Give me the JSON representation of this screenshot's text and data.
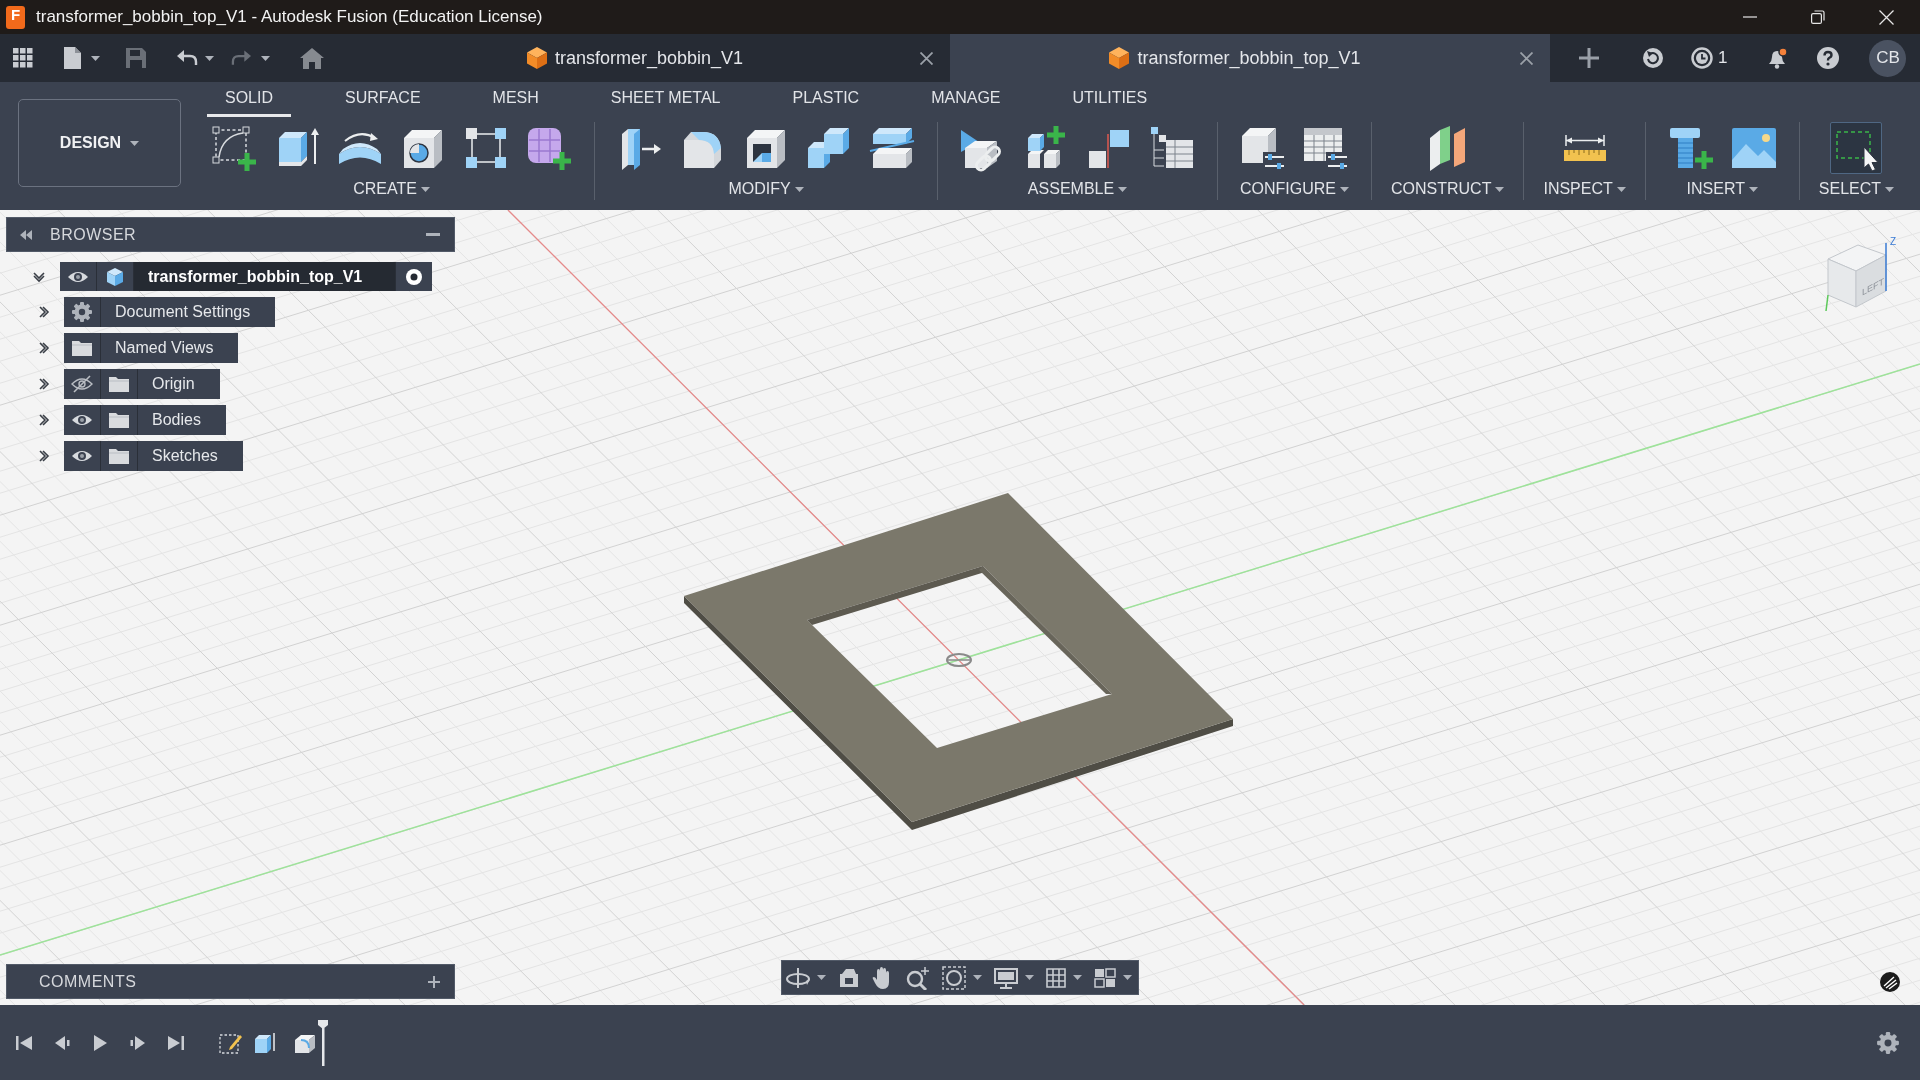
{
  "window": {
    "logo": "F",
    "title": "transformer_bobbin_top_V1 - Autodesk Fusion (Education License)"
  },
  "quick_access": {
    "save": {
      "disabled": true
    },
    "undo": {
      "disabled": false
    },
    "redo": {
      "disabled": true
    }
  },
  "document_tabs": [
    {
      "title": "transformer_bobbin_V1",
      "selected": false
    },
    {
      "title": "transformer_bobbin_top_V1",
      "selected": true
    }
  ],
  "header": {
    "job_count": "1",
    "unread_notifications": true,
    "avatar": "CB"
  },
  "workspace": {
    "label": "DESIGN"
  },
  "toolbar_tabs": [
    {
      "label": "SOLID",
      "selected": true
    },
    {
      "label": "SURFACE",
      "selected": false
    },
    {
      "label": "MESH",
      "selected": false
    },
    {
      "label": "SHEET METAL",
      "selected": false
    },
    {
      "label": "PLASTIC",
      "selected": false
    },
    {
      "label": "MANAGE",
      "selected": false
    },
    {
      "label": "UTILITIES",
      "selected": false
    }
  ],
  "tool_groups": [
    {
      "label": "CREATE",
      "tools": [
        {
          "selected": false
        },
        {
          "selected": false
        },
        {
          "selected": false
        },
        {
          "selected": false
        },
        {
          "selected": false
        },
        {
          "selected": false
        }
      ]
    },
    {
      "label": "MODIFY",
      "tools": [
        {
          "selected": false
        },
        {
          "selected": false
        },
        {
          "selected": false
        },
        {
          "selected": false
        },
        {
          "selected": false
        }
      ]
    },
    {
      "label": "ASSEMBLE",
      "tools": [
        {
          "selected": false
        },
        {
          "selected": false
        },
        {
          "selected": false
        },
        {
          "selected": false
        }
      ]
    },
    {
      "label": "CONFIGURE",
      "tools": [
        {
          "selected": false
        },
        {
          "selected": false
        }
      ]
    },
    {
      "label": "CONSTRUCT",
      "tools": [
        {
          "selected": false
        }
      ]
    },
    {
      "label": "INSPECT",
      "tools": [
        {
          "selected": false
        }
      ]
    },
    {
      "label": "INSERT",
      "tools": [
        {
          "selected": false
        },
        {
          "selected": false
        }
      ]
    },
    {
      "label": "SELECT",
      "tools": [
        {
          "selected": true
        }
      ]
    }
  ],
  "browser": {
    "title": "BROWSER",
    "root": {
      "kind": "component",
      "name": "transformer_bobbin_top_V1",
      "expanded": true,
      "visible": true,
      "active": true,
      "children": [
        {
          "kind": "settings",
          "name": "Document Settings",
          "expanded": false
        },
        {
          "kind": "views",
          "name": "Named Views",
          "expanded": false
        },
        {
          "kind": "folder",
          "name": "Origin",
          "expanded": false,
          "visible": false
        },
        {
          "kind": "folder",
          "name": "Bodies",
          "expanded": false,
          "visible": true
        },
        {
          "kind": "folder",
          "name": "Sketches",
          "expanded": false,
          "visible": true
        }
      ]
    }
  },
  "view_cube": {
    "face": "LEFT",
    "axis": "Z"
  },
  "comments": {
    "title": "COMMENTS"
  }
}
